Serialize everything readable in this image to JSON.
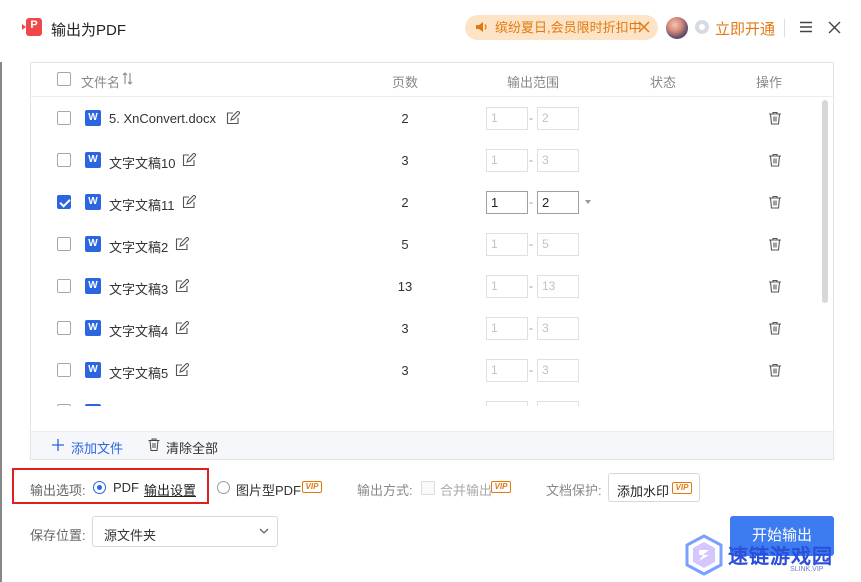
{
  "window": {
    "title": "输出为PDF"
  },
  "promo": {
    "text": "缤纷夏日,会员限时折扣中"
  },
  "header": {
    "open_vip": "立即开通"
  },
  "table": {
    "columns": {
      "name": "文件名",
      "pages": "页数",
      "range": "输出范围",
      "status": "状态",
      "action": "操作"
    },
    "rows": [
      {
        "name": "5. XnConvert.docx",
        "pages": "2",
        "from": "1",
        "to": "2",
        "checked": false
      },
      {
        "name": "文字文稿10",
        "pages": "3",
        "from": "1",
        "to": "3",
        "checked": false
      },
      {
        "name": "文字文稿11",
        "pages": "2",
        "from": "1",
        "to": "2",
        "checked": true
      },
      {
        "name": "文字文稿2",
        "pages": "5",
        "from": "1",
        "to": "5",
        "checked": false
      },
      {
        "name": "文字文稿3",
        "pages": "13",
        "from": "1",
        "to": "13",
        "checked": false
      },
      {
        "name": "文字文稿4",
        "pages": "3",
        "from": "1",
        "to": "3",
        "checked": false
      },
      {
        "name": "文字文稿5",
        "pages": "3",
        "from": "1",
        "to": "3",
        "checked": false
      }
    ],
    "file_icon": "W",
    "add_file": "添加文件",
    "clear_all": "清除全部"
  },
  "options": {
    "output_label": "输出选项:",
    "pdf": "PDF",
    "output_settings": "输出设置",
    "image_pdf": "图片型PDF",
    "vip_badge": "VIP",
    "mode_label": "输出方式:",
    "merge": "合并输出",
    "protect_label": "文档保护:",
    "watermark": "添加水印"
  },
  "save": {
    "label": "保存位置:",
    "value": "源文件夹"
  },
  "start_button": "开始输出",
  "brand": {
    "name": "速链游戏园",
    "sub": "SLINK.VIP"
  },
  "colors": {
    "accent": "#2b66e0",
    "promo": "#e07a10",
    "highlight_box": "#e02020"
  }
}
